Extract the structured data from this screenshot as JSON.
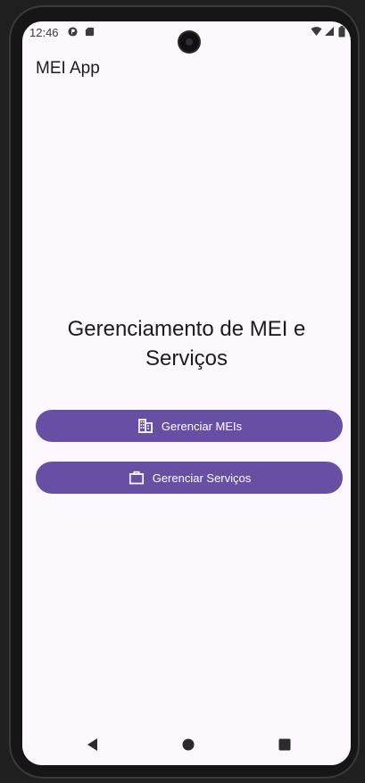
{
  "status_bar": {
    "time": "12:46"
  },
  "app_bar": {
    "title": "MEI App"
  },
  "main": {
    "heading": "Gerenciamento de MEI e Serviços",
    "buttons": [
      {
        "label": "Gerenciar MEIs",
        "icon": "building-icon"
      },
      {
        "label": "Gerenciar Serviços",
        "icon": "briefcase-icon"
      }
    ]
  },
  "colors": {
    "background": "#fdf7fe",
    "primary": "#6750a4",
    "on_primary": "#ffffff",
    "text": "#1d1b20"
  }
}
